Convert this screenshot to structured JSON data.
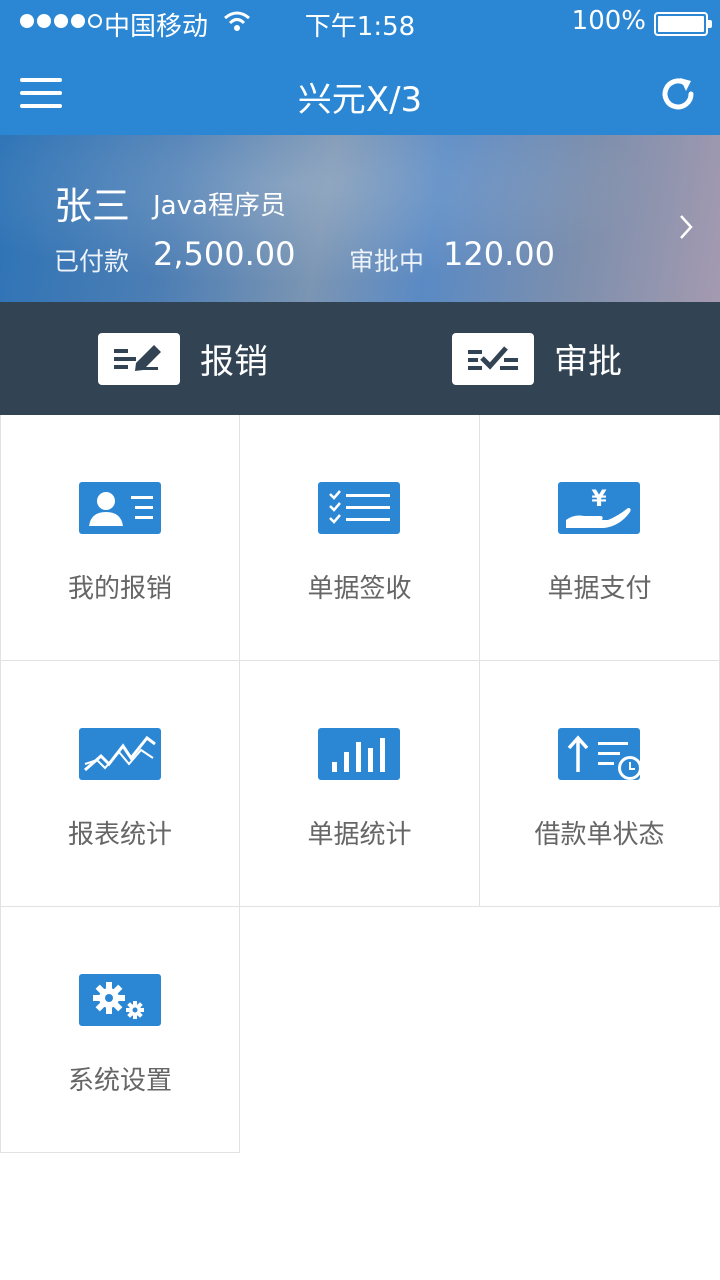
{
  "status_bar": {
    "carrier": "中国移动",
    "time": "下午1:58",
    "battery": "100%"
  },
  "nav": {
    "title": "兴元X/3"
  },
  "profile": {
    "name": "张三",
    "role": "Java程序员",
    "paid_label": "已付款",
    "paid_value": "2,500.00",
    "pending_label": "审批中",
    "pending_value": "120.00"
  },
  "actions": [
    {
      "label": "报销",
      "icon": "edit-form-icon"
    },
    {
      "label": "审批",
      "icon": "approve-check-icon"
    }
  ],
  "menu": [
    {
      "label": "我的报销",
      "icon": "id-card-icon"
    },
    {
      "label": "单据签收",
      "icon": "checklist-icon"
    },
    {
      "label": "单据支付",
      "icon": "yen-hand-icon"
    },
    {
      "label": "报表统计",
      "icon": "line-chart-icon"
    },
    {
      "label": "单据统计",
      "icon": "bar-chart-icon"
    },
    {
      "label": "借款单状态",
      "icon": "loan-clock-icon"
    },
    {
      "label": "系统设置",
      "icon": "gears-icon"
    }
  ],
  "colors": {
    "primary": "#2b87d3",
    "action_bar": "#324454",
    "label_gray": "#666666"
  }
}
